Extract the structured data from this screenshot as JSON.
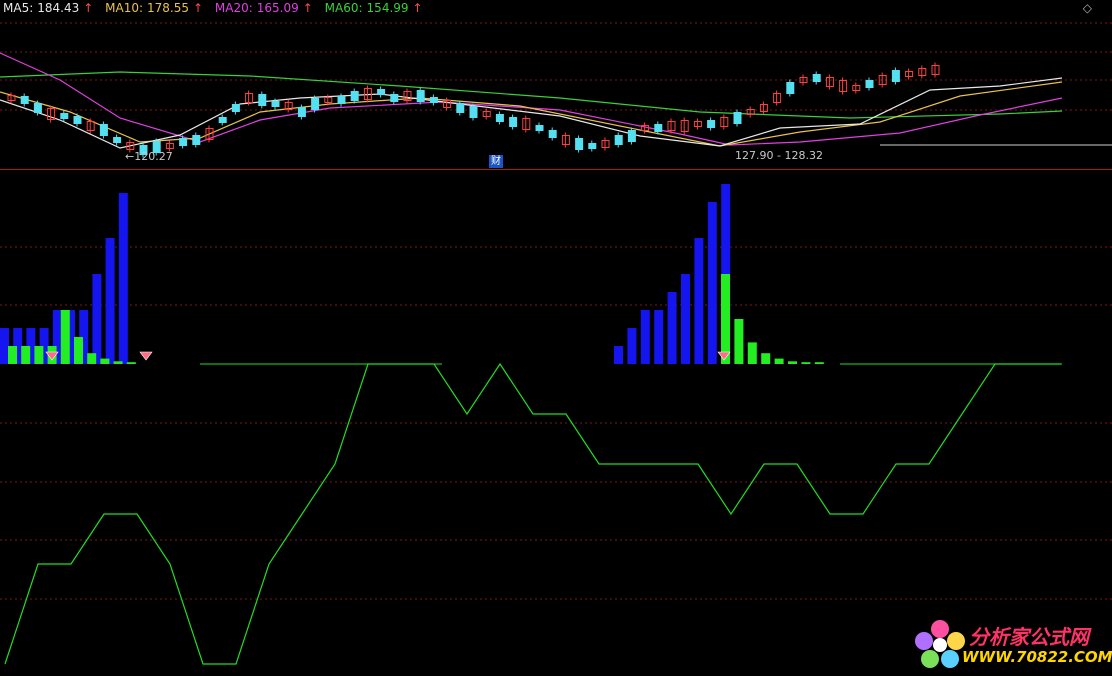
{
  "legend": {
    "ma5": {
      "label": "MA5:",
      "value": "184.43",
      "color": "#e8e8e8"
    },
    "ma10": {
      "label": "MA10:",
      "value": "178.55",
      "color": "#e8c24a"
    },
    "ma20": {
      "label": "MA20:",
      "value": "165.09",
      "color": "#e040e0"
    },
    "ma60": {
      "label": "MA60:",
      "value": "154.99",
      "color": "#3ad03a"
    },
    "arrow": "↑"
  },
  "corner_icon": "◇",
  "annotations": {
    "low_label": "←120.27",
    "range_label": "127.90 - 128.32",
    "cai_badge": "财"
  },
  "watermark": {
    "line1": "分析家公式网",
    "line2": "WWW.70822.COM"
  },
  "colors": {
    "up": "#ff4040",
    "down": "#54e0f0",
    "grid": "#7a1a1a",
    "divider": "#b01818",
    "bar_blue": "#1515f0",
    "bar_green": "#22ee22",
    "osc_line": "#22dd22",
    "marker": "#ff6b8b"
  },
  "indicator": {
    "left_wave": {
      "blue_bars": [
        2.0,
        2.0,
        2.0,
        2.0,
        3.0,
        3.0,
        3.0,
        5.0,
        7.0,
        9.5
      ],
      "green_bars": [
        1.0,
        1.0,
        1.0,
        1.0,
        3.0,
        1.5,
        0.6,
        0.3,
        0.15,
        0.1
      ]
    },
    "right_wave": {
      "blue_bars": [
        1.0,
        2.0,
        3.0,
        3.0,
        4.0,
        5.0,
        7.0,
        9.0,
        10.0
      ],
      "green_bars": [
        5.0,
        2.5,
        1.2,
        0.6,
        0.3,
        0.15,
        0.1,
        0.1
      ]
    },
    "oscillator": [
      -6.0,
      -4.0,
      -4.0,
      -3.0,
      -3.0,
      -4.0,
      -6.0,
      -6.0,
      -4.0,
      -3.0,
      -2.0,
      0.0,
      0.0,
      0.0,
      -1.0,
      0.0,
      -1.0,
      -1.0,
      -2.0,
      -2.0,
      -2.0,
      -2.0,
      -3.0,
      -2.0,
      -2.0,
      -3.0,
      -3.0,
      -2.0,
      -2.0,
      -1.0,
      0.0,
      0.0,
      0.0
    ]
  }
}
